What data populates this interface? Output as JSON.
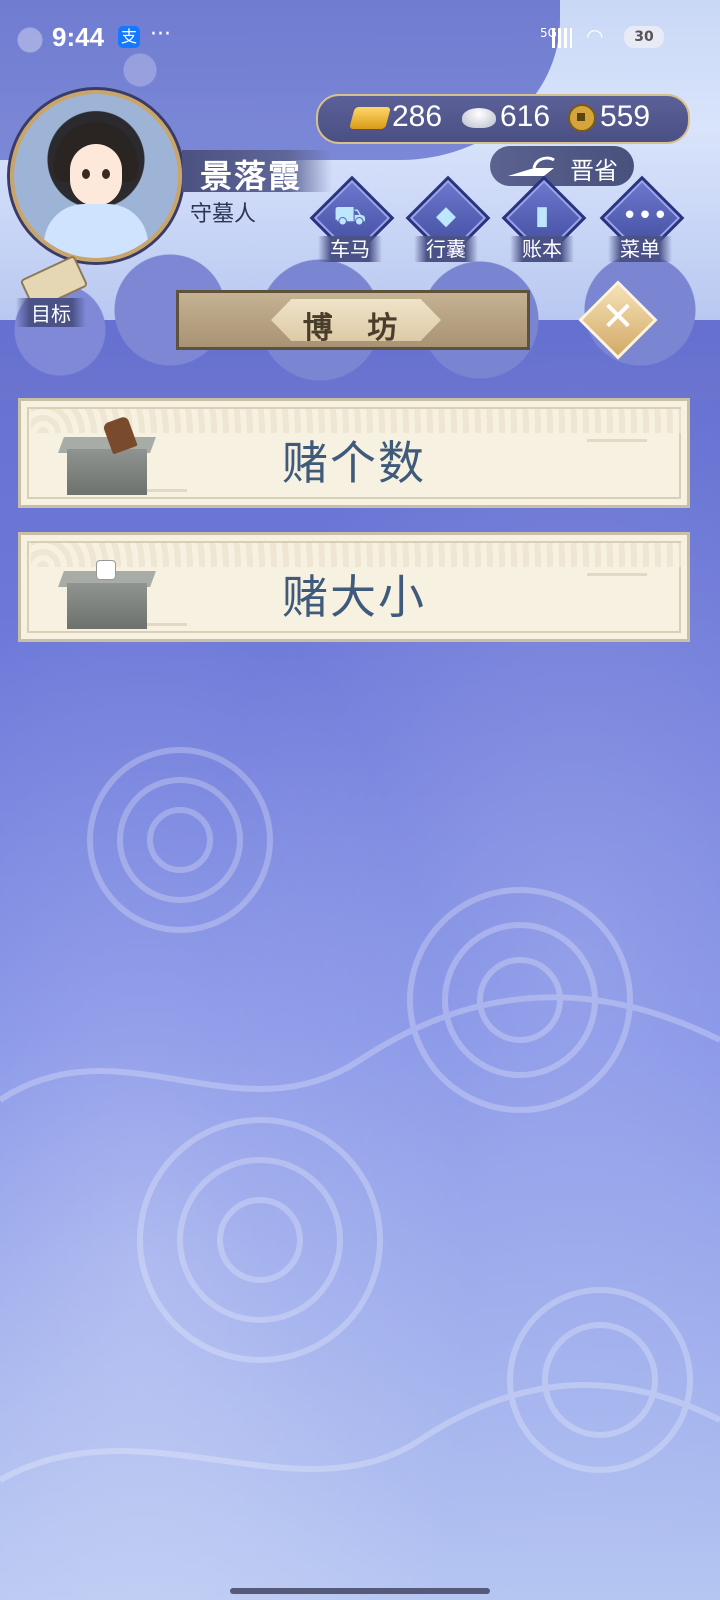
{
  "status_bar": {
    "time": "9:44",
    "app_badge": "支",
    "more": "···",
    "network": "5G",
    "battery": "30"
  },
  "player": {
    "name": "景落霞",
    "title": "守墓人"
  },
  "currency": {
    "gold": "286",
    "silver": "616",
    "copper": "559"
  },
  "region": {
    "label": "晋省"
  },
  "nav": [
    {
      "label": "车马",
      "icon": "carriage-icon"
    },
    {
      "label": "行囊",
      "icon": "bag-icon"
    },
    {
      "label": "账本",
      "icon": "ledger-icon"
    },
    {
      "label": "菜单",
      "icon": "menu-dots-icon"
    }
  ],
  "goal": {
    "label": "目标"
  },
  "page": {
    "title": "博 坊"
  },
  "options": [
    {
      "label": "赌个数",
      "icon": "dice-cup-icon"
    },
    {
      "label": "赌大小",
      "icon": "dice-table-icon"
    }
  ],
  "colors": {
    "accent_gold": "#d7c08c",
    "card_bg": "#f6f1e1",
    "option_text": "#3f5a7a"
  }
}
